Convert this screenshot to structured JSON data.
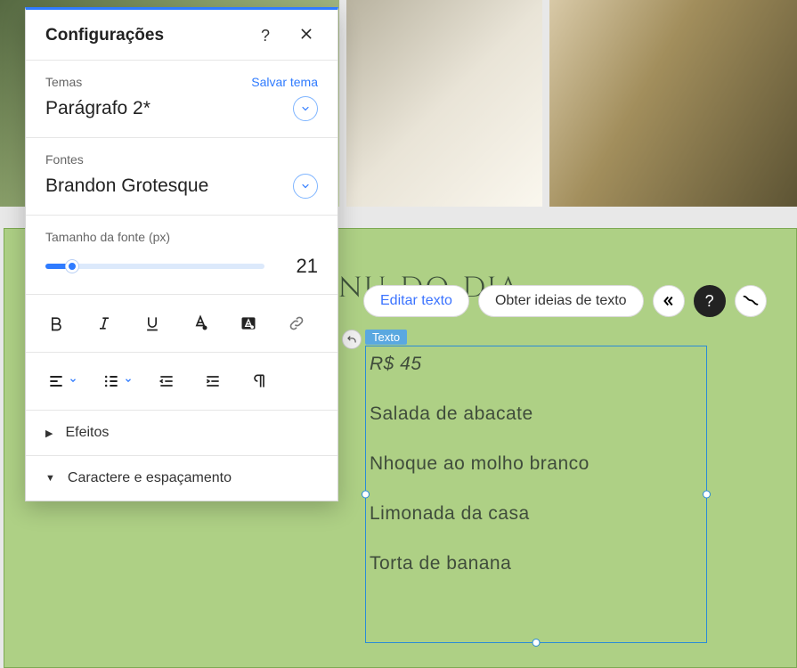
{
  "panel": {
    "title": "Configurações",
    "themes": {
      "label": "Temas",
      "save_link": "Salvar tema",
      "value": "Parágrafo 2*"
    },
    "fonts": {
      "label": "Fontes",
      "value": "Brandon Grotesque"
    },
    "font_size": {
      "label": "Tamanho da fonte (px)",
      "value": "21"
    },
    "effects_label": "Efeitos",
    "spacing_label": "Caractere e espaçamento"
  },
  "toolbar": {
    "edit_text": "Editar texto",
    "ideas": "Obter ideias de texto"
  },
  "canvas": {
    "heading": "Menu do dia",
    "text_chip": "Texto",
    "text_lines": {
      "price": "R$ 45",
      "l1": "Salada de abacate",
      "l2": "Nhoque ao molho branco",
      "l3": "Limonada da casa",
      "l4": "Torta de banana"
    }
  }
}
